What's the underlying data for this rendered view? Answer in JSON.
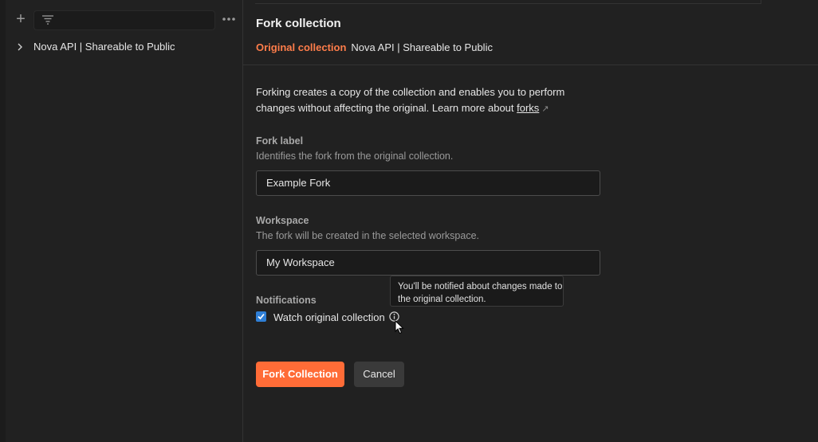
{
  "sidebar": {
    "add_icon": "plus-icon",
    "filter_icon": "filter-icon",
    "more_icon": "more-horizontal-icon",
    "items": [
      {
        "label": "Nova API | Shareable to Public",
        "icon": "chevron-right-icon"
      }
    ]
  },
  "main": {
    "title": "Fork collection",
    "original_label": "Original collection",
    "original_value": "Nova API | Shareable to Public",
    "description_prefix": "Forking creates a copy of the collection and enables you to perform changes without affecting the original. Learn more about ",
    "description_link": "forks",
    "fork_label": {
      "label": "Fork label",
      "help": "Identifies the fork from the original collection.",
      "value": "Example Fork"
    },
    "workspace": {
      "label": "Workspace",
      "help": "The fork will be created in the selected workspace.",
      "value": "My Workspace"
    },
    "notifications": {
      "label": "Notifications",
      "checkbox_label": "Watch original collection",
      "checked": true,
      "tooltip": "You'll be notified about changes made to the original collection."
    },
    "buttons": {
      "primary": "Fork Collection",
      "secondary": "Cancel"
    }
  },
  "colors": {
    "accent": "#ff6c37",
    "original_label": "#ff7d4a",
    "checkbox": "#2f7fd6",
    "background": "#212121"
  }
}
